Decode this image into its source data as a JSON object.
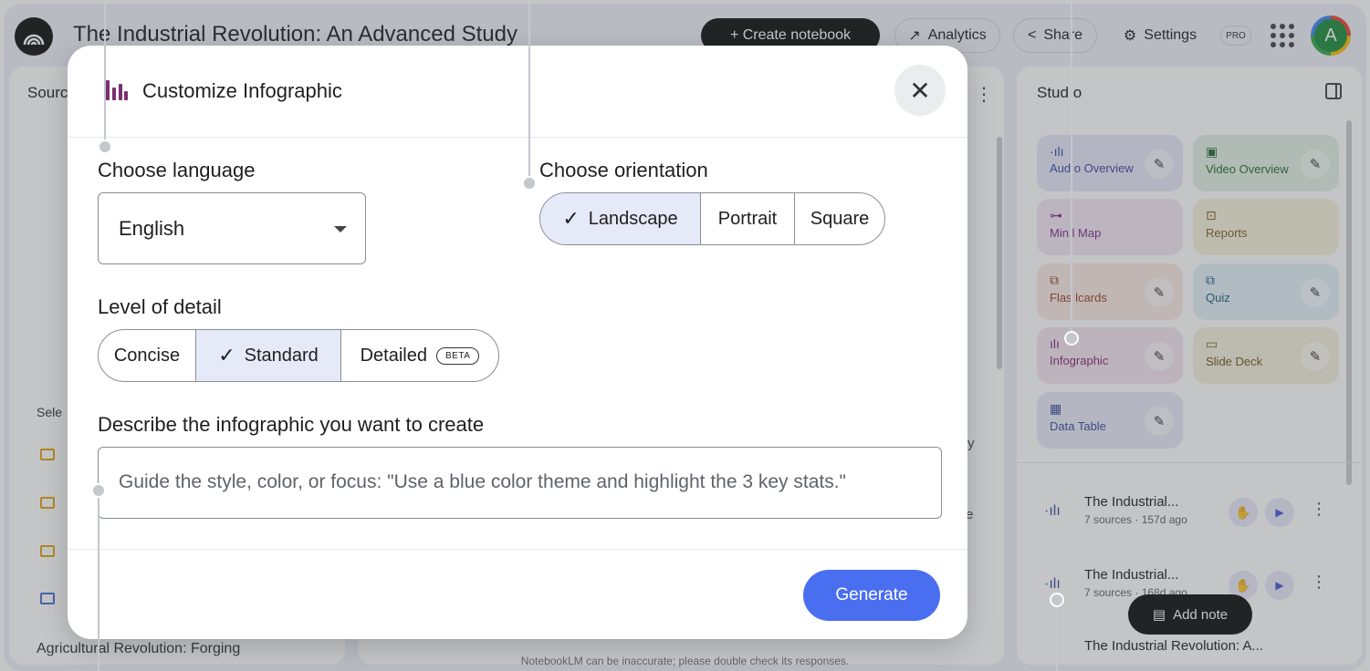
{
  "header": {
    "title": "The Industrial Revolution: An Advanced Study",
    "create_label": "+ Create notebook",
    "analytics_label": "Analytics",
    "share_label": "Share",
    "settings_label": "Settings",
    "pro_badge": "PRO",
    "avatar_letter": "A"
  },
  "sources": {
    "heading": "Sourc",
    "select_label": "Sele",
    "last_item": "Agricultural Revolution: Forging"
  },
  "chat": {
    "fragment_y": "y",
    "fragment_e": "e"
  },
  "studio": {
    "heading": "Stud o",
    "tiles": {
      "audio": "Aud o Overview",
      "video": "Video Overview",
      "mind": "Min l Map",
      "reports": "Reports",
      "flash": "Flas lcards",
      "quiz": "Quiz",
      "info": "Infographic",
      "slide": "Slide Deck",
      "data": "Data Table"
    },
    "items": [
      {
        "title": "The Industrial...",
        "meta": "7 sources · 157d ago"
      },
      {
        "title": "The Industrial...",
        "meta": "7 sources · 168d ago"
      },
      {
        "title": "The Industrial Revolution: A...",
        "meta": ""
      }
    ],
    "add_note": "Add note"
  },
  "footer": "NotebookLM can be inaccurate; please double check its responses.",
  "modal": {
    "title": "Customize Infographic",
    "language_label": "Choose language",
    "language_value": "English",
    "orientation_label": "Choose orientation",
    "orientation_options": [
      "Landscape",
      "Portrait",
      "Square"
    ],
    "orientation_selected": "Landscape",
    "detail_label": "Level of detail",
    "detail_options": [
      "Concise",
      "Standard",
      "Detailed"
    ],
    "detail_selected": "Standard",
    "beta_badge": "BETA",
    "describe_label": "Describe the infographic you want to create",
    "describe_placeholder": "Guide the style, color, or focus: \"Use a blue color theme and highlight the 3 key stats.\"",
    "generate_label": "Generate"
  },
  "colors": {
    "accent": "#4a6ef0",
    "selected_segment": "#e6e9f8",
    "infographic_icon": "#7b2e6e"
  }
}
